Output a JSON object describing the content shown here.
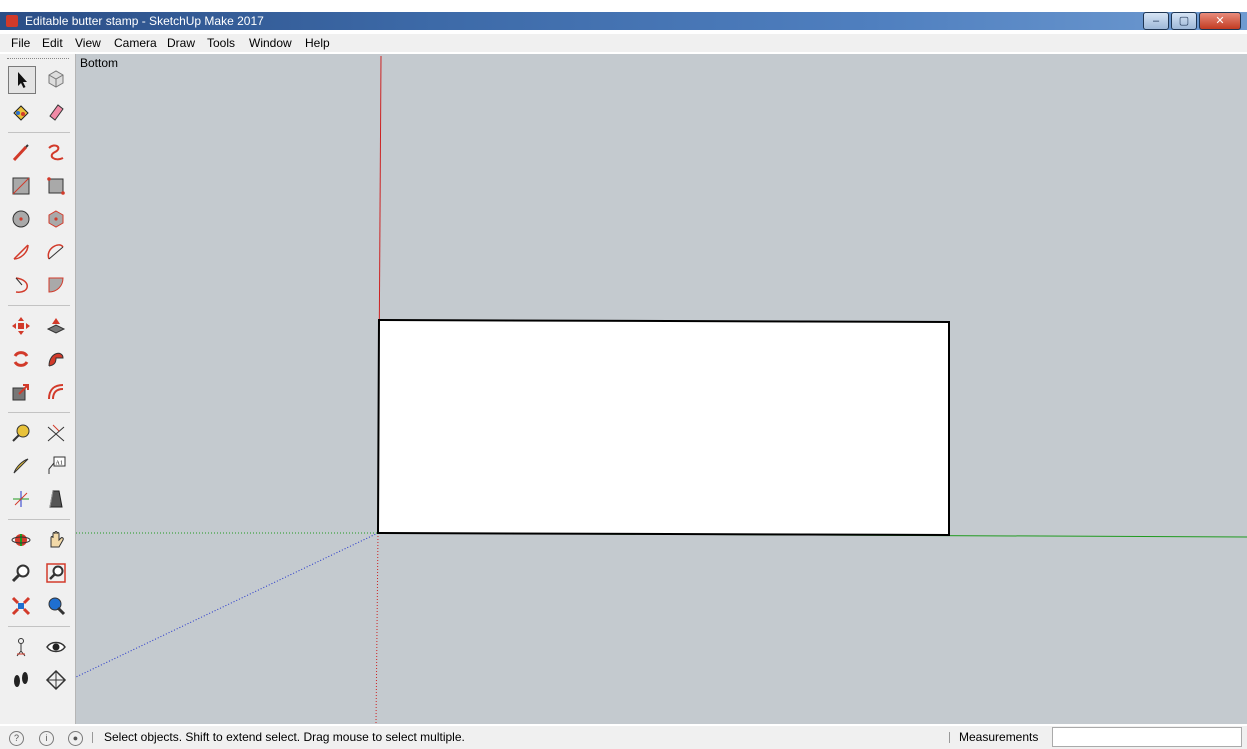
{
  "window": {
    "title": "Editable butter stamp - SketchUp Make 2017",
    "buttons": [
      "minimize",
      "maximize",
      "close"
    ]
  },
  "menu": [
    "File",
    "Edit",
    "View",
    "Camera",
    "Draw",
    "Tools",
    "Window",
    "Help"
  ],
  "viewport": {
    "view_label": "Bottom"
  },
  "tools": [
    {
      "name": "select-tool-icon",
      "active": true
    },
    {
      "name": "make-component-icon"
    },
    {
      "name": "paint-bucket-icon"
    },
    {
      "name": "eraser-icon"
    },
    {
      "name": "line-icon"
    },
    {
      "name": "freehand-icon"
    },
    {
      "name": "rectangle-icon"
    },
    {
      "name": "rotated-rectangle-icon"
    },
    {
      "name": "circle-icon"
    },
    {
      "name": "polygon-icon"
    },
    {
      "name": "arc-icon"
    },
    {
      "name": "two-point-arc-icon"
    },
    {
      "name": "three-point-arc-icon"
    },
    {
      "name": "pie-icon"
    },
    {
      "name": "move-icon"
    },
    {
      "name": "push-pull-icon"
    },
    {
      "name": "rotate-icon"
    },
    {
      "name": "follow-me-icon"
    },
    {
      "name": "scale-icon"
    },
    {
      "name": "offset-icon"
    },
    {
      "name": "tape-measure-icon"
    },
    {
      "name": "dimension-icon"
    },
    {
      "name": "protractor-icon"
    },
    {
      "name": "text-icon"
    },
    {
      "name": "axes-icon"
    },
    {
      "name": "3d-text-icon"
    },
    {
      "name": "orbit-icon"
    },
    {
      "name": "pan-icon"
    },
    {
      "name": "zoom-icon"
    },
    {
      "name": "zoom-window-icon"
    },
    {
      "name": "zoom-extents-icon"
    },
    {
      "name": "previous-view-icon"
    },
    {
      "name": "position-camera-icon"
    },
    {
      "name": "look-around-icon"
    },
    {
      "name": "walk-icon"
    },
    {
      "name": "section-plane-icon"
    }
  ],
  "text_tool_label": "A1",
  "status": {
    "hint": "Select objects. Shift to extend select. Drag mouse to select multiple.",
    "measurements_label": "Measurements",
    "measurements_value": ""
  },
  "colors": {
    "viewport_bg": "#c4cacf",
    "red_axis": "#cc2222",
    "green_axis": "#1f9a1f",
    "blue_axis": "#2233cc",
    "face": "#ffffff"
  }
}
